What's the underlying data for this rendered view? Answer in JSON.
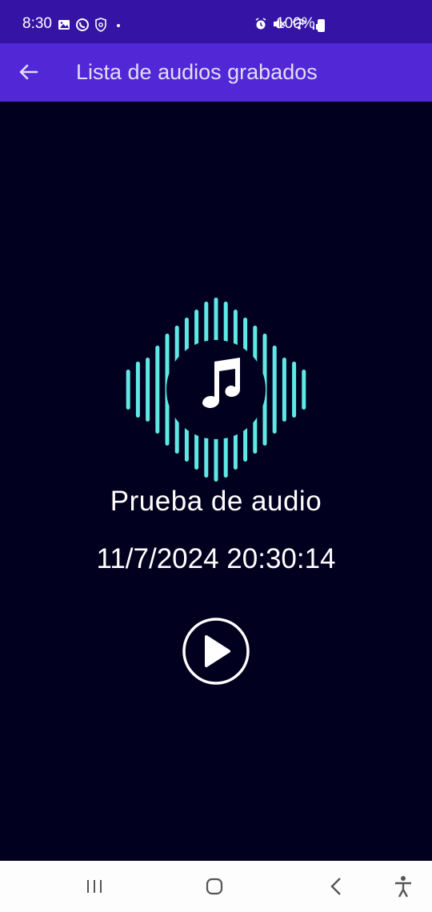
{
  "status_bar": {
    "time": "8:30",
    "battery": "100%"
  },
  "app_bar": {
    "title": "Lista de audios grabados"
  },
  "audio": {
    "name": "Prueba de audio",
    "datetime": "11/7/2024 20:30:14"
  },
  "colors": {
    "status_bar": "#3413a5",
    "app_bar": "#5127d6",
    "background": "#02001f",
    "waveform": "#5fe9e5"
  },
  "icons": {
    "back": "arrow-left-icon",
    "music": "music-note-icon",
    "play": "play-icon",
    "nav_recent": "recent-apps-icon",
    "nav_home": "home-icon",
    "nav_back": "back-icon",
    "accessibility": "accessibility-icon"
  }
}
